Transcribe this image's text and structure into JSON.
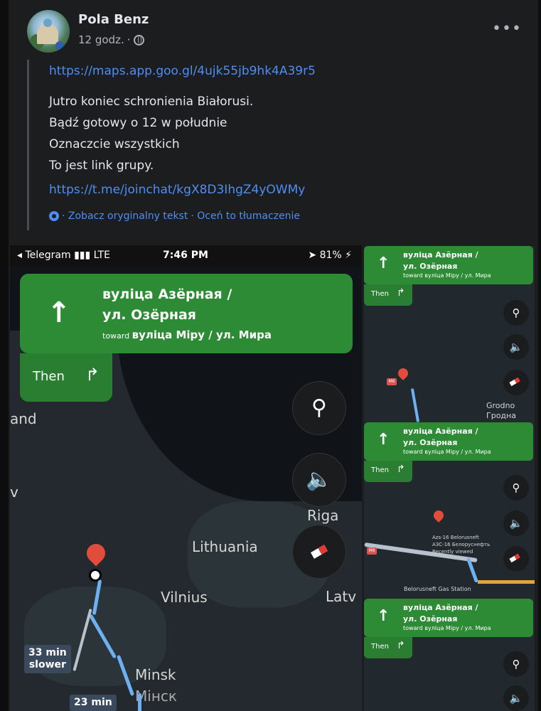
{
  "post": {
    "author": "Pola Benz",
    "time": "12 godz.",
    "separator": "·",
    "link1": "https://maps.app.goo.gl/4ujk55jb9hk4A39r5",
    "lines": [
      "Jutro koniec schronienia Białorusi.",
      "Bądź gotowy o 12 w południe",
      "Oznaczcie wszystkich",
      "To jest link grupy."
    ],
    "link2": "https://t.me/joinchat/kgX8D3IhgZ4yOWMy",
    "translate_see": "· Zobacz oryginalny tekst",
    "translate_rate": "· Oceń to tłumaczenie",
    "more": "•••"
  },
  "main_screenshot": {
    "status_left": "◂ Telegram ▮▮▮ LTE",
    "status_time": "7:46 PM",
    "status_right": "➤ 81% ⚡",
    "nav_arrow": "↑",
    "street1": "вуліца Азёрная /",
    "street2": "ул. Озёрная",
    "toward_prefix": "toward",
    "toward_street": "вуліца Міру / ул. Мира",
    "then_label": "Then",
    "then_arrow": "↱",
    "search_icon": "⚲",
    "sound_icon": "🔈",
    "labels": {
      "land": "and",
      "v": "v",
      "riga": "Riga",
      "lithuania": "Lithuania",
      "vilnius": "Vilnius",
      "latv": "Latv",
      "minsk": "Minsk",
      "minsk_ru": "Мінск"
    },
    "badge1_line1": "33 min",
    "badge1_line2": "slower",
    "badge2_line1": "23 min"
  },
  "small_screenshots": [
    {
      "street1": "вуліца Азёрная /",
      "street2": "ул. Озёрная",
      "toward": "toward вуліца Міру / ул. Мира",
      "then": "Then",
      "labels": [
        "Grodno",
        "Гродна"
      ],
      "badge": "M6"
    },
    {
      "street1": "вуліца Азёрная /",
      "street2": "ул. Озёрная",
      "toward": "toward вуліца Міру / ул. Мира",
      "then": "Then",
      "labels": [
        "Azs-16 Belorusneft",
        "АЗС-16 Белоруснефть",
        "Recently viewed",
        "Belorusneft Gas Station"
      ],
      "badge": "M6"
    },
    {
      "street1": "вуліца Азёрная /",
      "street2": "ул. Озёрная",
      "toward": "toward вуліца Міру / ул. Мира",
      "then": "Then",
      "labels": [],
      "badge": ""
    }
  ]
}
